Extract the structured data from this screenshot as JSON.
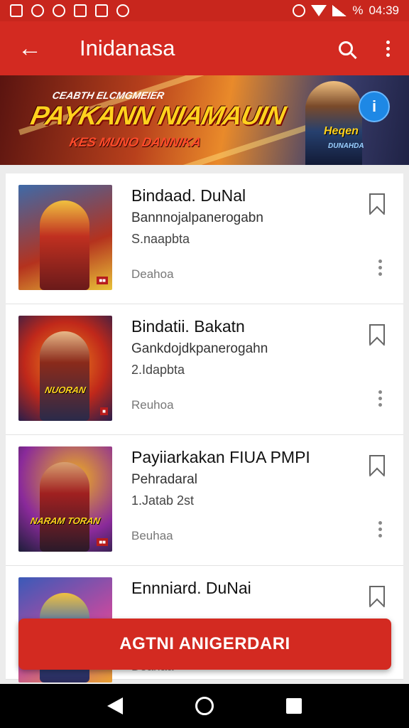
{
  "status_bar": {
    "battery": "%",
    "time": "04:39"
  },
  "app_bar": {
    "title": "Inidanasa"
  },
  "banner": {
    "kicker": "CEABTH ELCMGMEIER",
    "title": "PAYKANN NIAMAUIN",
    "subtitle": "KES MUNO DANNIKA",
    "logo": "Heqen",
    "logo_sub": "DUNAHDA"
  },
  "items": [
    {
      "title": "Bindaad. DuNal",
      "subtitle": "Bannnojalpanerogabn",
      "meta": "S.naapbta",
      "status": "Deahoa",
      "cover_text": "",
      "colors": [
        "#3e6aa8",
        "#b4321e",
        "#e8c238"
      ]
    },
    {
      "title": "Bindatii. Bakatn",
      "subtitle": "Gankdojdkpanerogahn",
      "meta": "2.Idapbta",
      "status": "Reuhoa",
      "cover_text": "NUORAN",
      "colors": [
        "#c0281a",
        "#f08a1c",
        "#2a1e4a"
      ]
    },
    {
      "title": "Payiiarkakan FIUA PMPI",
      "subtitle": "Pehradaral",
      "meta": "1.Jatab 2st",
      "status": "Beuhaa",
      "cover_text": "NARAM TORAN",
      "colors": [
        "#f0b020",
        "#8a2a9a",
        "#1e1e3a"
      ]
    },
    {
      "title": "Ennniard. DuNai",
      "subtitle": "",
      "meta": "",
      "status": "Deahaa",
      "cover_text": "",
      "colors": [
        "#3a5ab8",
        "#c04aa0",
        "#e8a030"
      ]
    }
  ],
  "cta": {
    "label": "AGTNI ANIGERDARI"
  },
  "icons": {
    "back": "arrow-left-icon",
    "search": "search-icon",
    "more": "more-vertical-icon",
    "bookmark": "bookmark-icon"
  },
  "colors": {
    "primary": "#d32a21",
    "status_bar": "#c8261d"
  }
}
